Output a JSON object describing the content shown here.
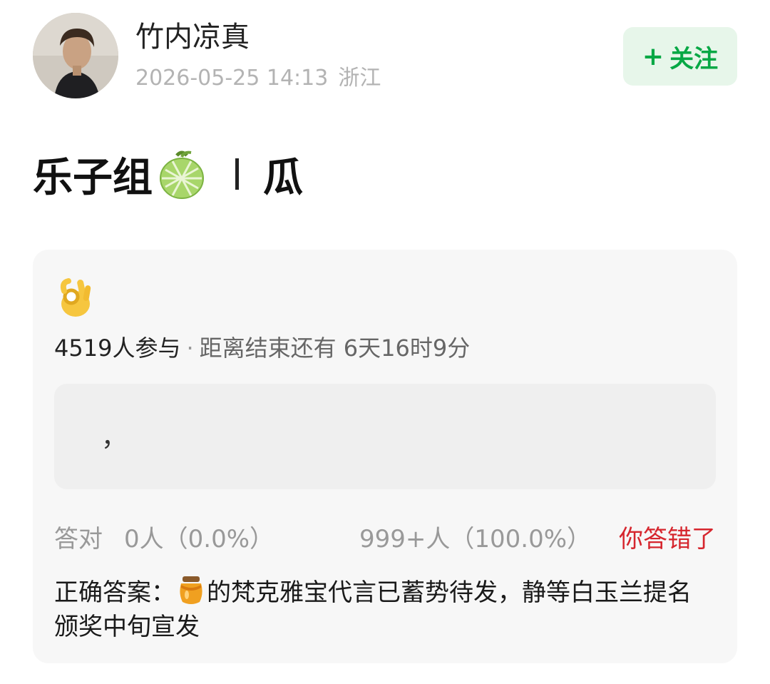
{
  "header": {
    "username": "竹内凉真",
    "timestamp": "2026-05-25 14:13",
    "location": "浙江",
    "follow": {
      "icon": "plus-icon",
      "label": "关注"
    }
  },
  "post": {
    "title_text": "乐子组",
    "title_emoji": "melon-icon",
    "title_suffix": "瓜"
  },
  "quiz": {
    "emoji": "ok-hand-icon",
    "participants": "4519人参与",
    "separator": "·",
    "remaining": "距离结束还有 6天16时9分",
    "option_text": "，",
    "correct_label": "答对",
    "correct_count": "0人（0.0%）",
    "selected_count": "999+人（100.0%）",
    "result_label": "你答错了",
    "answer_prefix": "正确答案：",
    "answer_emoji": "honey-pot-icon",
    "answer_text": "的梵克雅宝代言已蓄势待发，静等白玉兰提名颁奖中旬宣发"
  },
  "colors": {
    "accent_green": "#07a845",
    "follow_bg": "#e7f6ea",
    "wrong_red": "#d6262e",
    "card_bg": "#f7f7f7"
  }
}
